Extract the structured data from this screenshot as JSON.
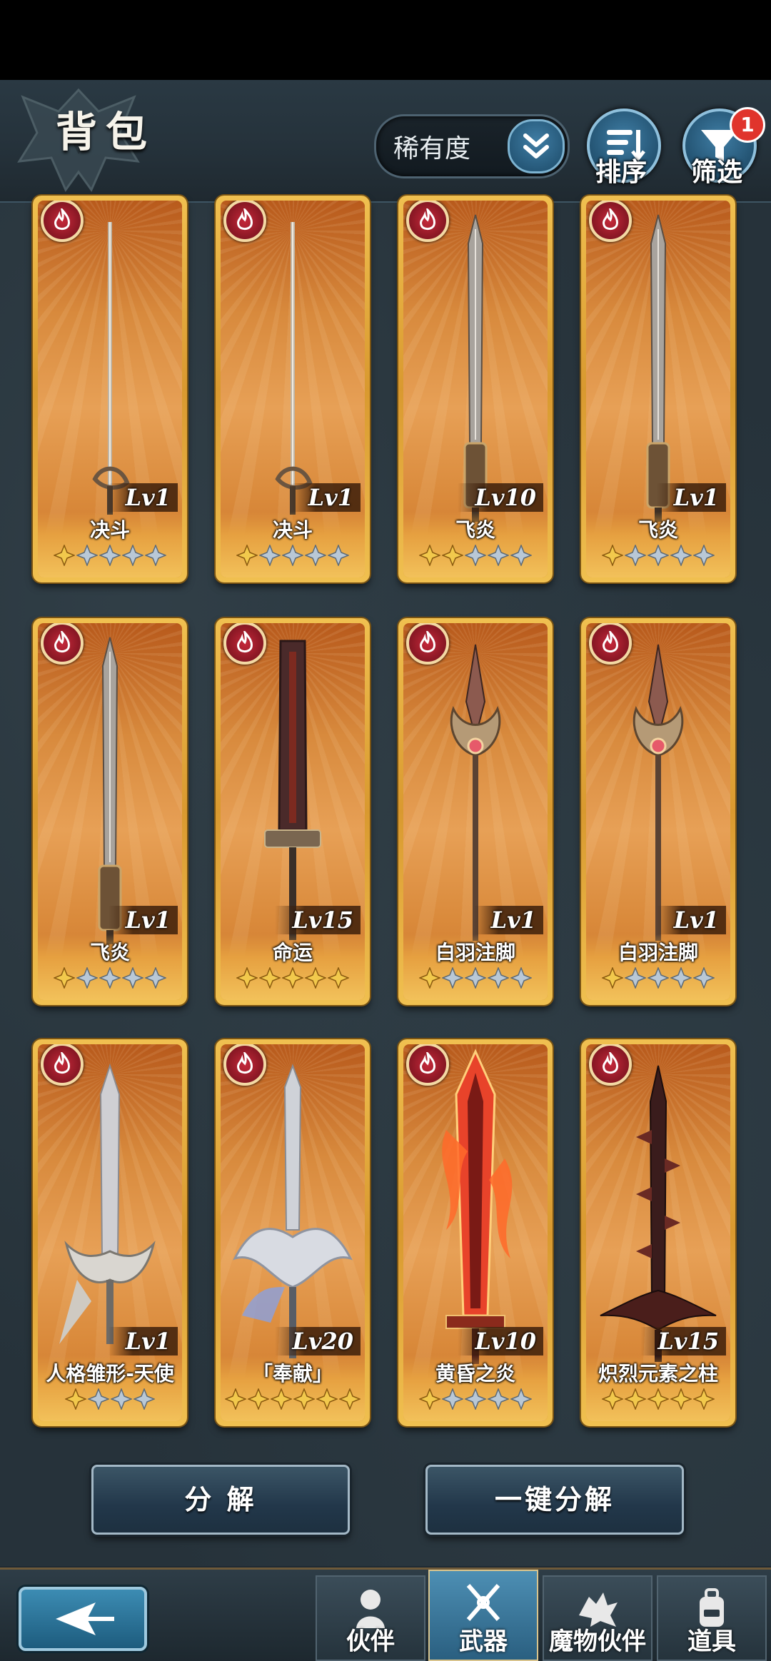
{
  "header": {
    "title": "背包",
    "rarity_select": "稀有度",
    "sort_label": "排序",
    "filter_label": "筛选",
    "filter_badge": "1"
  },
  "cards": [
    {
      "name": "决斗",
      "level": "Lv1",
      "stars_total": 5,
      "stars_filled": 1,
      "weapon": "rapier"
    },
    {
      "name": "决斗",
      "level": "Lv1",
      "stars_total": 5,
      "stars_filled": 1,
      "weapon": "rapier"
    },
    {
      "name": "飞炎",
      "level": "Lv10",
      "stars_total": 5,
      "stars_filled": 2,
      "weapon": "longsword"
    },
    {
      "name": "飞炎",
      "level": "Lv1",
      "stars_total": 5,
      "stars_filled": 1,
      "weapon": "longsword"
    },
    {
      "name": "飞炎",
      "level": "Lv1",
      "stars_total": 5,
      "stars_filled": 1,
      "weapon": "longsword"
    },
    {
      "name": "命运",
      "level": "Lv15",
      "stars_total": 5,
      "stars_filled": 5,
      "weapon": "greatsword"
    },
    {
      "name": "白羽注脚",
      "level": "Lv1",
      "stars_total": 5,
      "stars_filled": 1,
      "weapon": "spear"
    },
    {
      "name": "白羽注脚",
      "level": "Lv1",
      "stars_total": 5,
      "stars_filled": 1,
      "weapon": "spear"
    },
    {
      "name": "人格雏形-天使",
      "level": "Lv1",
      "stars_total": 4,
      "stars_filled": 1,
      "weapon": "angel"
    },
    {
      "name": "「奉献」",
      "level": "Lv20",
      "stars_total": 6,
      "stars_filled": 6,
      "weapon": "winged"
    },
    {
      "name": "黄昏之炎",
      "level": "Lv10",
      "stars_total": 5,
      "stars_filled": 1,
      "weapon": "flame"
    },
    {
      "name": "炽烈元素之柱",
      "level": "Lv15",
      "stars_total": 5,
      "stars_filled": 5,
      "weapon": "spiked"
    }
  ],
  "actions": {
    "decompose": "分 解",
    "one_click_decompose": "一键分解"
  },
  "bottom_nav": {
    "tabs": [
      "伙伴",
      "武器",
      "魔物伙伴",
      "道具"
    ],
    "active": "武器"
  },
  "colors": {
    "card_frame": "#e9b447",
    "card_bg": "#d88a3d",
    "element_fire": "#c5283a",
    "star_filled": "#f2c94c",
    "star_empty": "#b9c8d6",
    "accent_blue": "#3f7da4"
  }
}
